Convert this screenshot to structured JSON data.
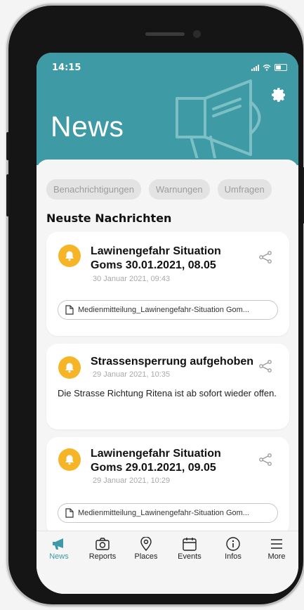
{
  "status": {
    "time": "14:15"
  },
  "header": {
    "title": "News",
    "icon": "megaphone-icon"
  },
  "filters": [
    "Benachrichtigungen",
    "Warnungen",
    "Umfragen"
  ],
  "section_title": "Neuste Nachrichten",
  "cards": [
    {
      "title": "Lawinengefahr Situation Goms 30.01.2021, 08.05",
      "date": "30 Januar 2021, 09:43",
      "attachment": "Medienmitteilung_Lawinengefahr-Situation Gom..."
    },
    {
      "title": "Strassensperrung aufgehoben",
      "date": "29 Januar 2021, 10:35",
      "body": "Die Strasse Richtung Ritena ist ab sofort wieder offen."
    },
    {
      "title": "Lawinengefahr Situation Goms 29.01.2021, 09.05",
      "date": "29 Januar 2021, 10:29",
      "attachment": "Medienmitteilung_Lawinengefahr-Situation Gom..."
    }
  ],
  "tabs": [
    "News",
    "Reports",
    "Places",
    "Events",
    "Infos",
    "More"
  ],
  "colors": {
    "accent": "#3e9aa4",
    "bell": "#f6b526"
  }
}
